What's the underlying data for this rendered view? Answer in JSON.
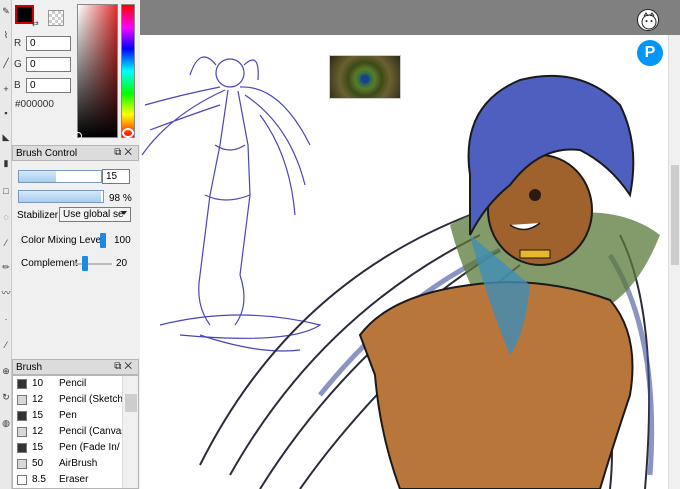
{
  "color_panel": {
    "r_label": "R",
    "r_value": "0",
    "g_label": "G",
    "g_value": "0",
    "b_label": "B",
    "b_value": "0",
    "hex": "#000000",
    "foreground_color": "#000000"
  },
  "brush_control": {
    "title": "Brush Control",
    "size_value": "15",
    "size_fill": 0.45,
    "density_text": "98 %",
    "density_fill": 0.98,
    "stabilizer_label": "Stabilizer",
    "stabilizer_value": "Use global se",
    "color_mixing_label": "Color Mixing Level",
    "color_mixing_value": "100",
    "complement_label": "Complement",
    "complement_value": "20"
  },
  "brush_panel": {
    "title": "Brush",
    "items": [
      {
        "size": "10",
        "name": "Pencil",
        "swatch": "#333333"
      },
      {
        "size": "12",
        "name": "Pencil (Sketch",
        "swatch": "#d8d8d8"
      },
      {
        "size": "15",
        "name": "Pen",
        "swatch": "#333333"
      },
      {
        "size": "12",
        "name": "Pencil (Canvas",
        "swatch": "#d8d8d8"
      },
      {
        "size": "15",
        "name": "Pen (Fade In/",
        "swatch": "#333333"
      },
      {
        "size": "50",
        "name": "AirBrush",
        "swatch": "#d8d8d8"
      },
      {
        "size": "8.5",
        "name": "Eraser",
        "swatch": "#ffffff"
      }
    ]
  },
  "overlay": {
    "pixiv_letter": "P"
  }
}
